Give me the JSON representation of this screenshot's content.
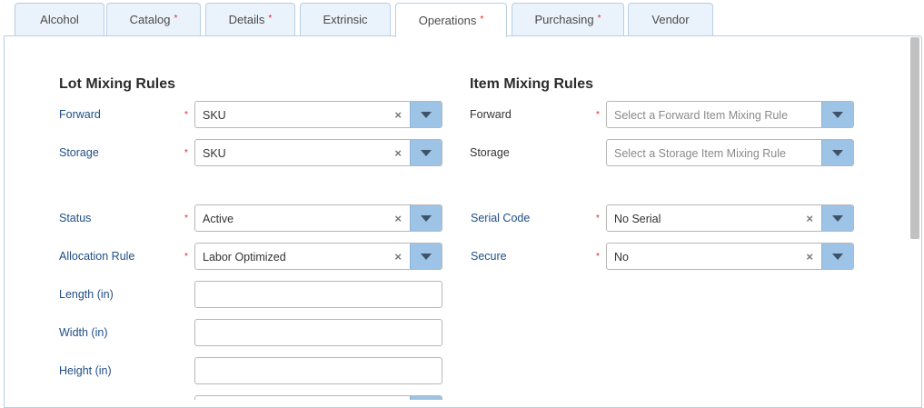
{
  "tabs": [
    {
      "label": "Alcohol",
      "required": false
    },
    {
      "label": "Catalog",
      "required": true
    },
    {
      "label": "Details",
      "required": true
    },
    {
      "label": "Extrinsic",
      "required": false
    },
    {
      "label": "Operations",
      "required": true
    },
    {
      "label": "Purchasing",
      "required": true
    },
    {
      "label": "Vendor",
      "required": false
    }
  ],
  "required_marker": "*",
  "clear_glyph": "×",
  "lot": {
    "title": "Lot Mixing Rules",
    "forward": {
      "label": "Forward",
      "value": "SKU"
    },
    "storage": {
      "label": "Storage",
      "value": "SKU"
    }
  },
  "item": {
    "title": "Item Mixing Rules",
    "forward": {
      "label": "Forward",
      "placeholder": "Select a Forward Item Mixing Rule"
    },
    "storage": {
      "label": "Storage",
      "placeholder": "Select a Storage Item Mixing Rule"
    }
  },
  "fields": {
    "status": {
      "label": "Status",
      "value": "Active"
    },
    "allocation_rule": {
      "label": "Allocation Rule",
      "value": "Labor Optimized"
    },
    "length": {
      "label": "Length (in)",
      "value": ""
    },
    "width": {
      "label": "Width (in)",
      "value": ""
    },
    "height": {
      "label": "Height (in)",
      "value": ""
    },
    "serial_code": {
      "label": "Serial Code",
      "value": "No Serial"
    },
    "secure": {
      "label": "Secure",
      "value": "No"
    }
  }
}
